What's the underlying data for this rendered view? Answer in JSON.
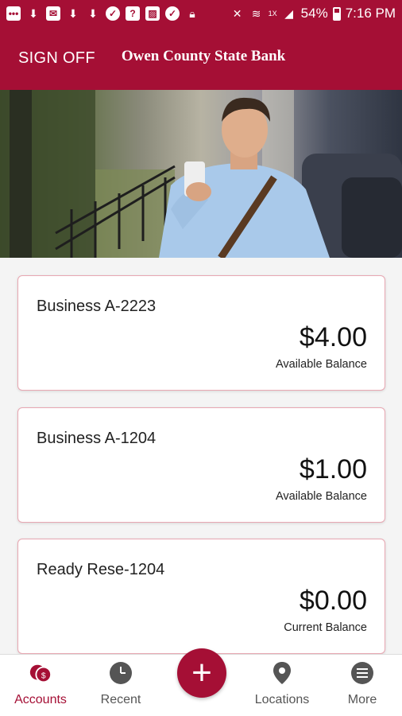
{
  "status_bar": {
    "battery": "54%",
    "time": "7:16 PM",
    "lte_label": "1X"
  },
  "header": {
    "sign_off": "SIGN OFF",
    "bank_name": "Owen County State Bank"
  },
  "accounts": [
    {
      "name": "Business A-2223",
      "amount": "$4.00",
      "balance_label": "Available Balance"
    },
    {
      "name": "Business A-1204",
      "amount": "$1.00",
      "balance_label": "Available Balance"
    },
    {
      "name": "Ready Rese-1204",
      "amount": "$0.00",
      "balance_label": "Current Balance"
    }
  ],
  "bottom_nav": {
    "accounts": "Accounts",
    "recent": "Recent",
    "locations": "Locations",
    "more": "More",
    "add_symbol": "+"
  },
  "colors": {
    "brand": "#a50f35",
    "card_border": "#e8a7b2",
    "nav_inactive": "#555555"
  }
}
